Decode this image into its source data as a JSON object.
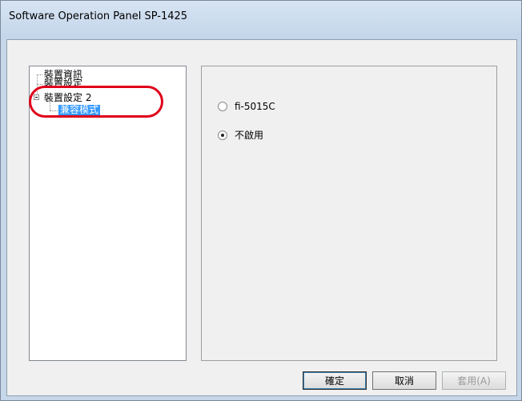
{
  "window": {
    "title": "Software Operation Panel SP-1425"
  },
  "tree": {
    "items": [
      {
        "label": "裝置資訊"
      },
      {
        "label": "裝置設定"
      },
      {
        "label": "裝置設定 2"
      },
      {
        "label": "兼容模式",
        "selected": true
      }
    ],
    "expander": "collapse-box-icon"
  },
  "options": {
    "items": [
      {
        "label": "fi-5015C",
        "checked": false
      },
      {
        "label": "不啟用",
        "checked": true
      }
    ]
  },
  "buttons": {
    "ok": "確定",
    "cancel": "取消",
    "apply": "套用(A)"
  },
  "colors": {
    "selection": "#3399ff",
    "annotation": "#e0001a",
    "titlebar": "#c7d7ea"
  }
}
